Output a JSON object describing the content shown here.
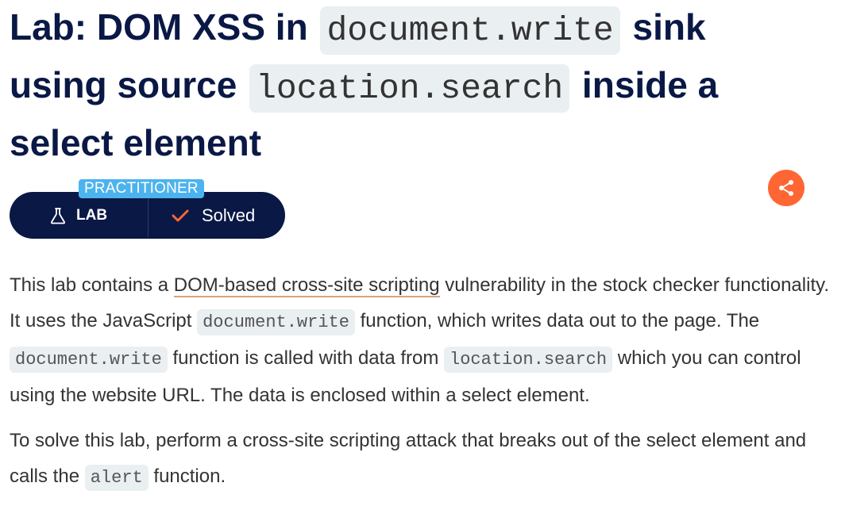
{
  "title": {
    "prefix": "Lab: DOM XSS in ",
    "code1": "document.write",
    "mid1": " sink using source ",
    "code2": "location.search",
    "suffix": " inside a select element"
  },
  "lab": {
    "level": "PRACTITIONER",
    "type": "LAB",
    "status": "Solved"
  },
  "colors": {
    "navy": "#0a1846",
    "badge_blue": "#4cb3ee",
    "share_orange": "#ff6633",
    "check_orange": "#ff6633",
    "code_bg": "#eaeff2"
  },
  "icons": {
    "lab": "flask-icon",
    "status": "check-icon",
    "share": "share-icon"
  },
  "description": {
    "p1": {
      "t1": "This lab contains a ",
      "link": "DOM-based cross-site scripting",
      "t2": " vulnerability in the stock checker functionality. It uses the JavaScript ",
      "code1": "document.write",
      "t3": " function, which writes data out to the page. The ",
      "code2": "document.write",
      "t4": " function is called with data from ",
      "code3": "location.search",
      "t5": " which you can control using the website URL. The data is enclosed within a select element."
    },
    "p2": {
      "t1": "To solve this lab, perform a cross-site scripting attack that breaks out of the select element and calls the ",
      "code1": "alert",
      "t2": " function."
    }
  }
}
